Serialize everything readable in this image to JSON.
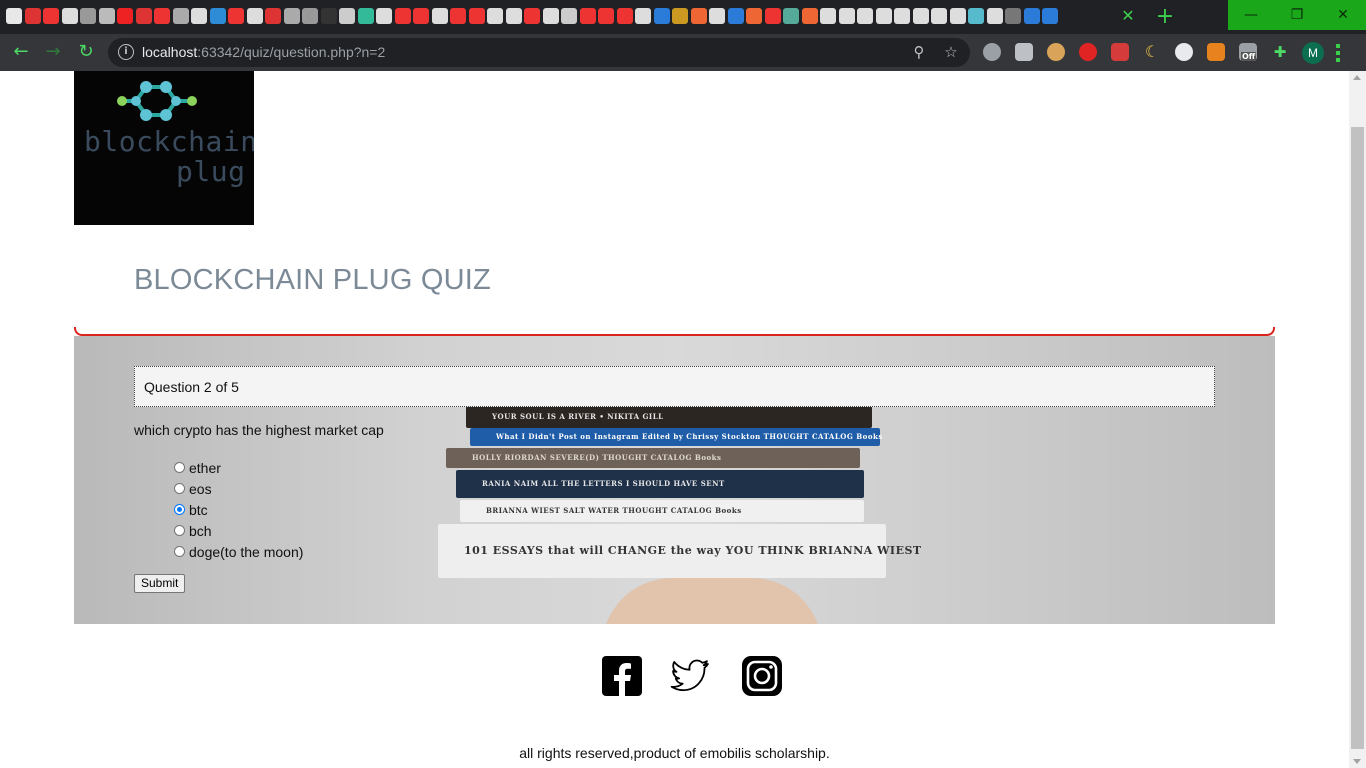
{
  "browser": {
    "url_host": "localhost",
    "url_path": ":63342/quiz/question.php?n=2",
    "tab_close_label": "✕",
    "new_tab_label": "+",
    "window_min": "—",
    "window_max": "❐",
    "window_close": "✕",
    "profile_initial": "M",
    "extension_badge": "Off",
    "tab_favicon_colors": [
      "#e8e8e8",
      "#d33",
      "#e33",
      "#ddd",
      "#999",
      "#bbb",
      "#e22",
      "#d33",
      "#e33",
      "#aaa",
      "#ddd",
      "#2e8bd6",
      "#e33",
      "#ddd",
      "#d33",
      "#aaa",
      "#999",
      "#333",
      "#ccc",
      "#3b9",
      "#ddd",
      "#e33",
      "#e33",
      "#ddd",
      "#e33",
      "#e33",
      "#ddd",
      "#ddd",
      "#e33",
      "#ddd",
      "#ccc",
      "#e33",
      "#e33",
      "#e33",
      "#ddd",
      "#2b7bd8",
      "#c92",
      "#e63",
      "#ddd",
      "#2b7bd8",
      "#e63",
      "#e33",
      "#5a9",
      "#e63",
      "#ddd",
      "#ddd",
      "#ddd",
      "#ddd",
      "#ddd",
      "#ddd",
      "#ddd",
      "#ddd",
      "#5bc",
      "#ddd",
      "#777",
      "#2b7bd8",
      "#2b7bd8"
    ]
  },
  "page": {
    "logo_line1": "blockchain",
    "logo_line2": "plug",
    "title": "BLOCKCHAIN PLUG QUIZ",
    "question_counter": "Question 2 of 5",
    "question_text": "which crypto has the highest market cap",
    "choices": [
      {
        "label": "ether",
        "selected": false
      },
      {
        "label": "eos",
        "selected": false
      },
      {
        "label": "btc",
        "selected": true
      },
      {
        "label": "bch",
        "selected": false
      },
      {
        "label": "doge(to the moon)",
        "selected": false
      }
    ],
    "submit_label": "Submit",
    "footer": "all rights reserved,product of emobilis scholarship.",
    "accent_color": "#d9251d"
  },
  "banner_books": [
    {
      "text": "YOUR SOUL IS A RIVER  •  NIKITA GILL",
      "color": "#2c2622"
    },
    {
      "text": "What I Didn't Post on Instagram     Edited by Chrissy Stockton     THOUGHT CATALOG Books",
      "color": "#1f5da8"
    },
    {
      "text": "HOLLY RIORDAN          SEVERE(D)          THOUGHT CATALOG Books",
      "color": "#6e6258"
    },
    {
      "text": "RANIA NAIM     ALL THE LETTERS I SHOULD HAVE SENT",
      "color": "#1f3049"
    },
    {
      "text": "BRIANNA WIEST          SALT WATER          THOUGHT CATALOG Books",
      "color": "#f0f0f0"
    },
    {
      "text": "101 ESSAYS that will CHANGE the way YOU THINK     BRIANNA WIEST",
      "color": "#eeeeee"
    }
  ]
}
